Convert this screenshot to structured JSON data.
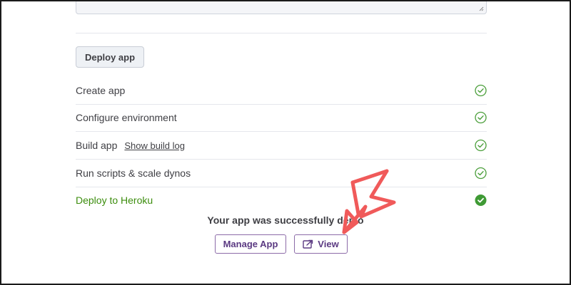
{
  "deploy_button": {
    "label": "Deploy app"
  },
  "steps": [
    {
      "label": "Create app",
      "icon": "check-circle-icon"
    },
    {
      "label": "Configure environment",
      "icon": "check-circle-icon"
    },
    {
      "label": "Build app",
      "link": "Show build log",
      "icon": "check-circle-icon"
    },
    {
      "label": "Run scripts & scale dynos",
      "icon": "check-circle-icon"
    },
    {
      "label": "Deploy to Heroku",
      "icon": "check-circle-filled-icon",
      "status": "complete"
    }
  ],
  "success_message": "Your app was successfully deplo",
  "actions": {
    "manage_label": "Manage App",
    "view_label": "View"
  },
  "colors": {
    "success_green": "#3c8d0d",
    "check_green": "#4a9e3a",
    "heroku_purple": "#5b3a82",
    "annotation_red": "#f05a5a"
  }
}
